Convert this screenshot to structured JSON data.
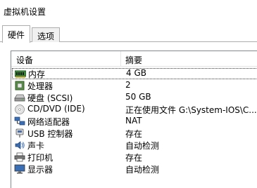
{
  "window": {
    "title": "虚拟机设置"
  },
  "tabs": [
    {
      "label": "硬件"
    },
    {
      "label": "选项"
    }
  ],
  "table": {
    "columns": [
      "设备",
      "摘要"
    ],
    "rows": [
      {
        "device": "内存",
        "summary": "4 GB",
        "icon": "memory-icon",
        "selected": true
      },
      {
        "device": "处理器",
        "summary": "2",
        "icon": "processor-icon"
      },
      {
        "device": "硬盘 (SCSI)",
        "summary": "50 GB",
        "icon": "harddisk-icon"
      },
      {
        "device": "CD/DVD (IDE)",
        "summary": "正在使用文件 G:\\System-IOS\\C...",
        "icon": "cd-dvd-icon"
      },
      {
        "device": "网络适配器",
        "summary": "NAT",
        "icon": "network-adapter-icon"
      },
      {
        "device": "USB 控制器",
        "summary": "存在",
        "icon": "usb-icon"
      },
      {
        "device": "声卡",
        "summary": "自动检测",
        "icon": "sound-card-icon"
      },
      {
        "device": "打印机",
        "summary": "存在",
        "icon": "printer-icon"
      },
      {
        "device": "显示器",
        "summary": "自动检测",
        "icon": "display-icon"
      }
    ]
  }
}
